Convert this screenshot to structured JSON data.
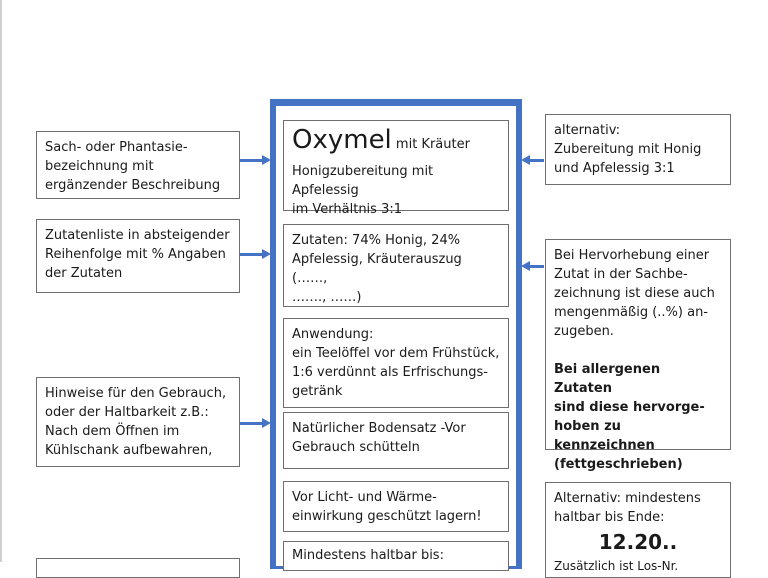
{
  "left_boxes": {
    "name": "Sach- oder Phantasie-\nbezeichnung mit\nergänzender Beschreibung",
    "ingredients": "Zutatenliste in absteigender\nReihenfolge mit % Angaben\nder Zutaten",
    "usage": "Hinweise für den Gebrauch,\noder der Haltbarkeit z.B.:\nNach dem Öffnen im\nKühlschank aufbewahren,"
  },
  "center": {
    "title_big": "Oxymel",
    "title_small": " mit Kräuter",
    "title_desc": "Honigzubereitung mit Apfelessig\nim Verhältnis 3:1",
    "ingredients": "Zutaten: 74% Honig, 24%\nApfelessig, Kräuterauszug (……,\n……., ……)",
    "application": "Anwendung:\nein Teelöffel vor dem Frühstück,\n1:6 verdünnt als Erfrischungs-\ngetränk",
    "sediment": "Natürlicher Bodensatz -Vor\nGebrauch schütteln",
    "storage": "Vor Licht- und Wärme-\neinwirkung geschützt lagern!",
    "best_before": "Mindestens haltbar bis:"
  },
  "right_boxes": {
    "alternative": "alternativ:\nZubereitung mit Honig\nund Apfelessig 3:1",
    "emphasis_text": "Bei Hervorhebung einer\nZutat in der Sachbe-\nzeichnung ist diese auch\nmengenmäßig (..%) an-\nzugeben.",
    "emphasis_bold": "Bei allergenen Zutaten\nsind diese hervorge-\nhoben zu kennzeichnen\n(fettgeschrieben)",
    "mhd_text": "Alternativ: mindestens\nhaltbar bis Ende:",
    "mhd_date": "12.20..",
    "mhd_cut": "Zusätzlich ist Los-Nr."
  },
  "colors": {
    "accent": "#4472c4",
    "border": "#6f6f6f"
  }
}
